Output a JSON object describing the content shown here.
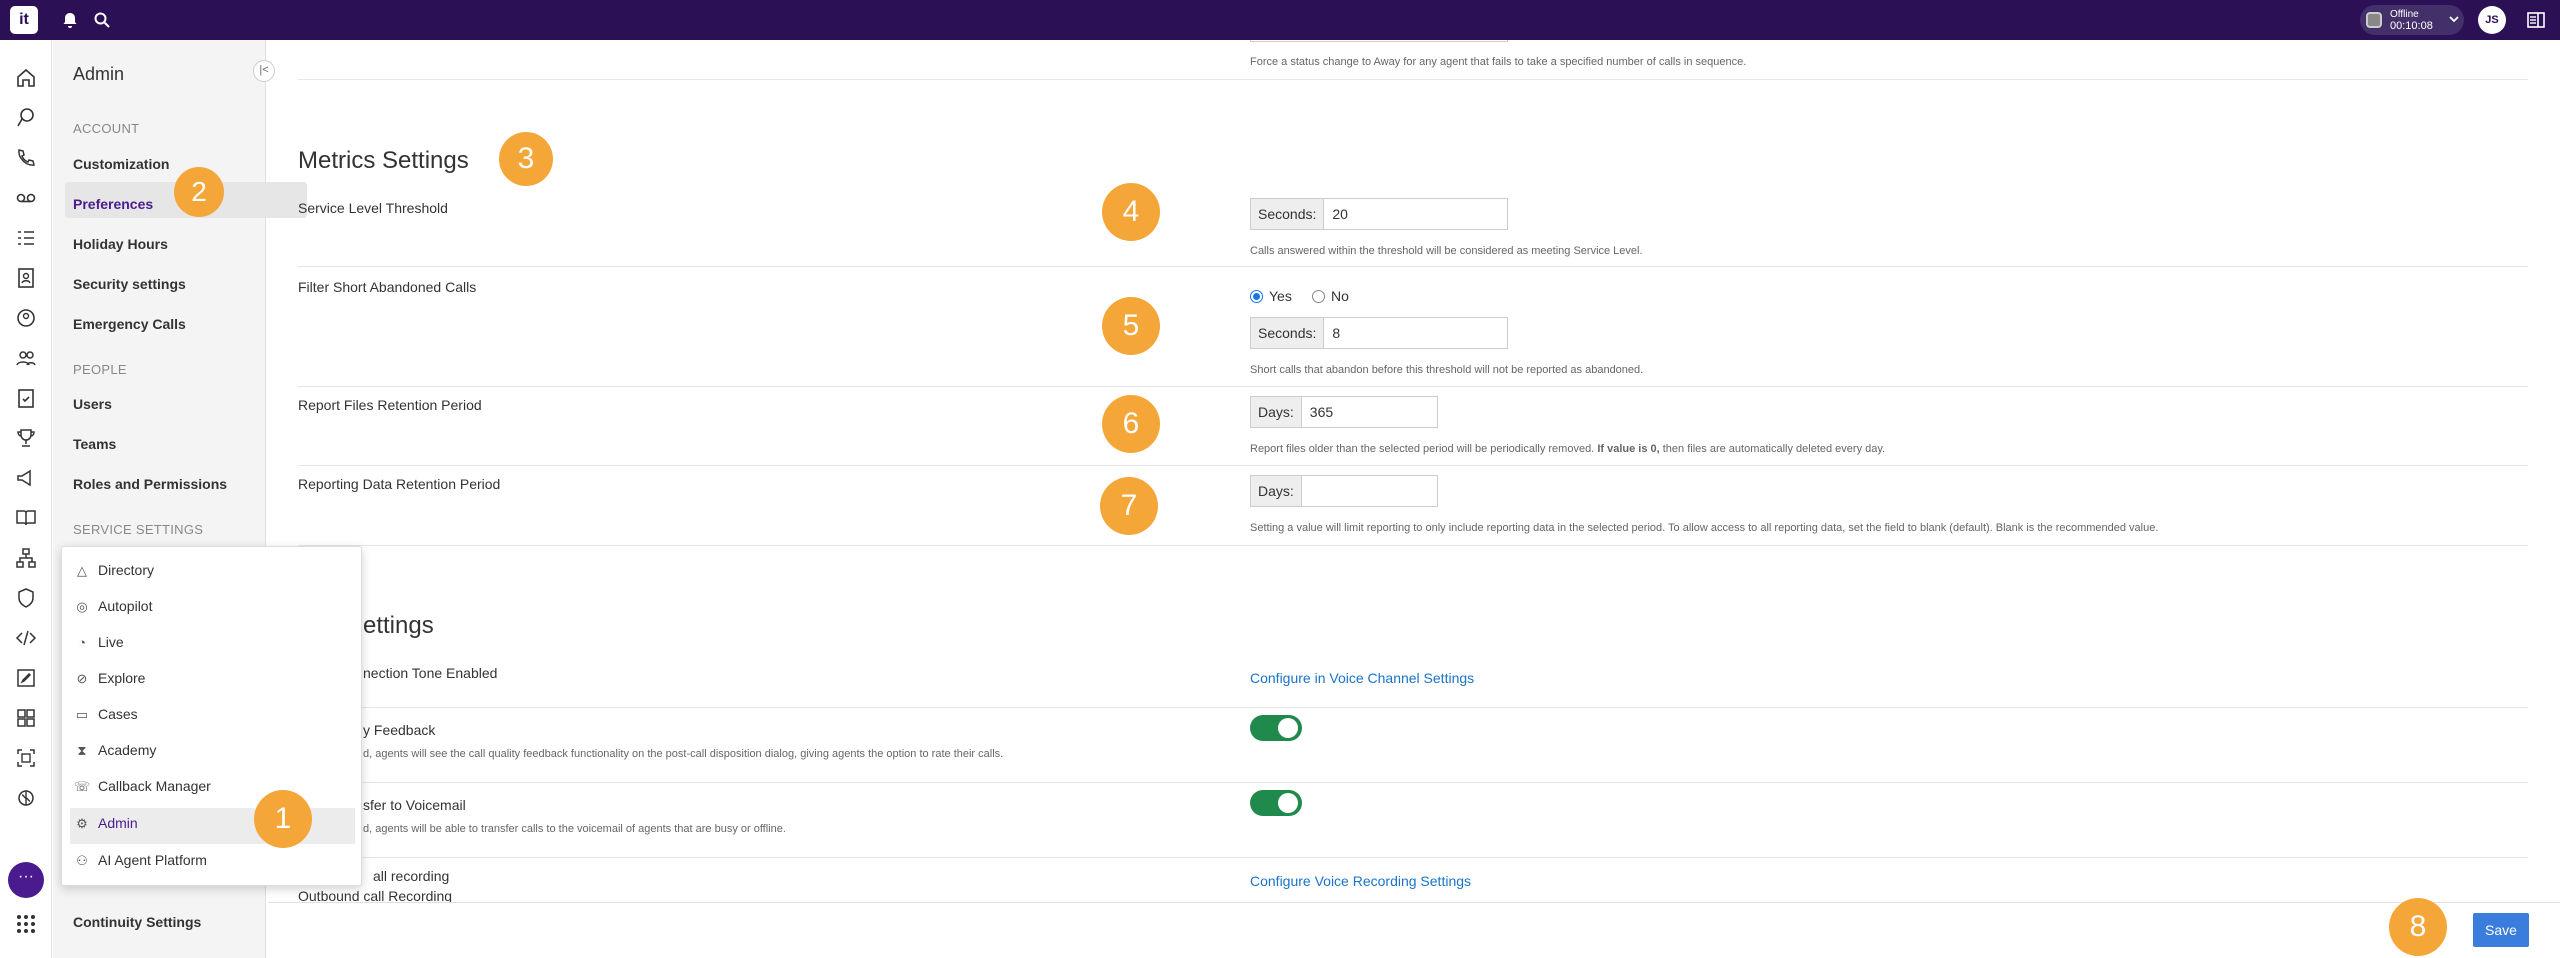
{
  "topbar": {
    "logo": "it",
    "status_label": "Offline",
    "status_time": "00:10:08",
    "avatar_initials": "JS"
  },
  "sidebar": {
    "title": "Admin",
    "account_header": "ACCOUNT",
    "account_items": [
      "Customization",
      "Preferences",
      "Holiday Hours",
      "Security settings",
      "Emergency Calls"
    ],
    "people_header": "PEOPLE",
    "people_items": [
      "Users",
      "Teams",
      "Roles and Permissions"
    ],
    "service_header": "SERVICE SETTINGS",
    "bottom_item": "Continuity Settings"
  },
  "app_menu": {
    "items": [
      "Directory",
      "Autopilot",
      "Live",
      "Explore",
      "Cases",
      "Academy",
      "Callback Manager",
      "Admin",
      "AI Agent Platform"
    ],
    "icons": [
      "triangle-icon",
      "autopilot-icon",
      "live-icon",
      "explore-icon",
      "cases-icon",
      "academy-icon",
      "callback-icon",
      "gear-icon",
      "ai-agent-icon"
    ]
  },
  "content": {
    "top_desc": "Force a status change to Away for any agent that fails to take a specified number of calls in sequence.",
    "metrics_title": "Metrics Settings",
    "service_level": {
      "label": "Service Level Threshold",
      "addon": "Seconds:",
      "value": "20",
      "desc": "Calls answered within the threshold will be considered as meeting Service Level."
    },
    "filter_short": {
      "label": "Filter Short Abandoned Calls",
      "yes": "Yes",
      "no": "No",
      "addon": "Seconds:",
      "value": "8",
      "desc": "Short calls that abandon before this threshold will not be reported as abandoned."
    },
    "report_files": {
      "label": "Report Files Retention Period",
      "addon": "Days:",
      "value": "365",
      "desc_a": "Report files older than the selected period will be periodically removed.",
      "desc_b": "If value is 0,",
      "desc_c": "then files are automatically deleted every day."
    },
    "reporting_data": {
      "label": "Reporting Data Retention Period",
      "addon": "Days:",
      "value": "",
      "desc": "Setting a value will limit reporting to only include reporting data in the selected period. To allow access to all reporting data, set the field to blank (default). Blank is the recommended value."
    },
    "voice_title": "ettings",
    "connection_tone": {
      "label": "nection Tone Enabled",
      "link": "Configure in Voice Channel Settings"
    },
    "quality_feedback": {
      "label": "y Feedback",
      "desc": "d, agents will see the call quality feedback functionality on the post-call disposition dialog, giving agents the option to rate their calls.",
      "on": true
    },
    "transfer_voicemail": {
      "label": "sfer to Voicemail",
      "desc": "d, agents will be able to transfer calls to the voicemail of agents that are busy or offline.",
      "on": true
    },
    "recording": {
      "label1": "all recording",
      "label2": "Outbound call Recording",
      "link": "Configure Voice Recording Settings"
    },
    "save": "Save"
  },
  "annotations": [
    "1",
    "2",
    "3",
    "4",
    "5",
    "6",
    "7",
    "8"
  ],
  "colors": {
    "topbar": "#2b1055",
    "accent": "#4a1b8f",
    "annotation": "#f5a638",
    "toggle_on": "#1f8a4c",
    "link": "#1a73c8",
    "save": "#3b7ddd"
  }
}
